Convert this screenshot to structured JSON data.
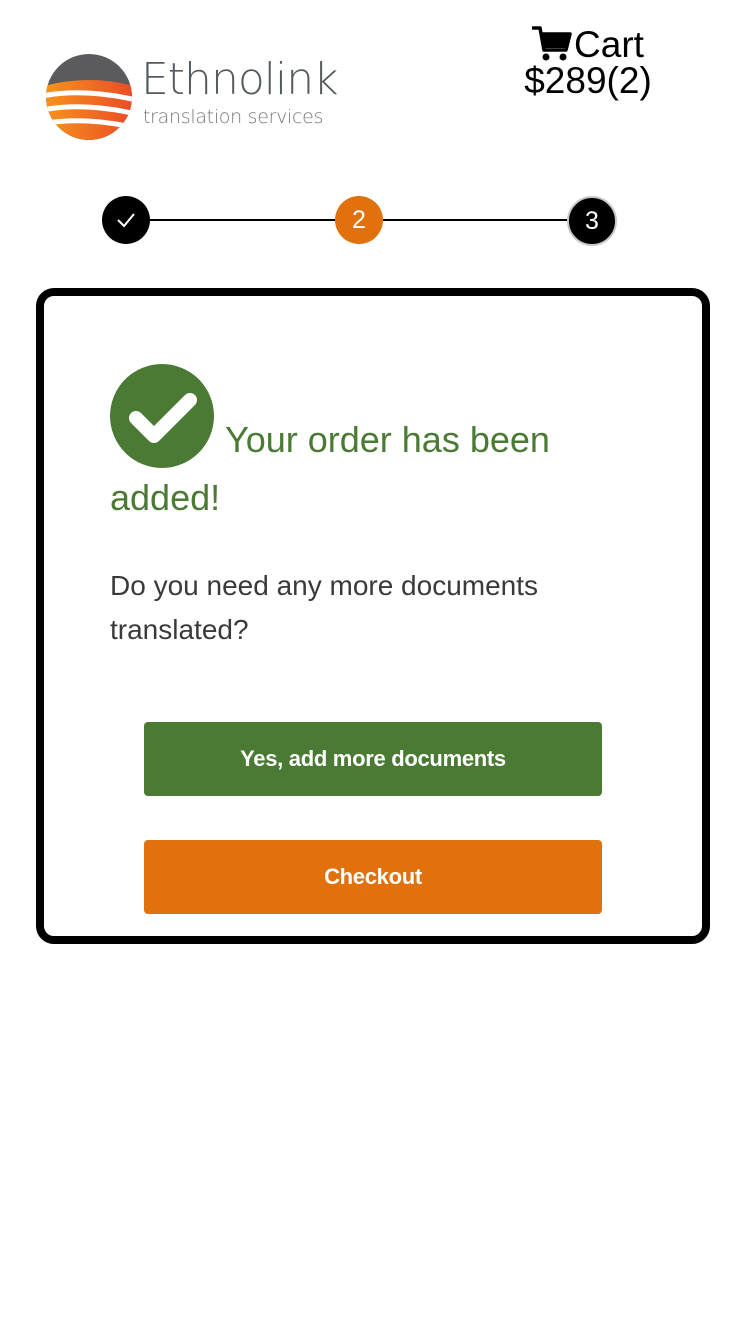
{
  "header": {
    "brand_name": "Ethnolink",
    "brand_tagline": "translation services",
    "cart_label": "Cart",
    "cart_total": "$289(2)",
    "cart_icon": "shopping-cart-icon"
  },
  "stepper": {
    "steps": [
      {
        "label": "",
        "state": "completed",
        "icon": "check-icon"
      },
      {
        "label": "2",
        "state": "current"
      },
      {
        "label": "3",
        "state": "upcoming"
      }
    ]
  },
  "card": {
    "success_icon": "check-circle-icon",
    "success_message": "Your order has been added!",
    "question": "Do you need any more documents translated?",
    "add_more_label": "Yes, add more documents",
    "checkout_label": "Checkout"
  },
  "colors": {
    "green": "#4a7a33",
    "orange": "#e0710c",
    "black": "#000000"
  }
}
